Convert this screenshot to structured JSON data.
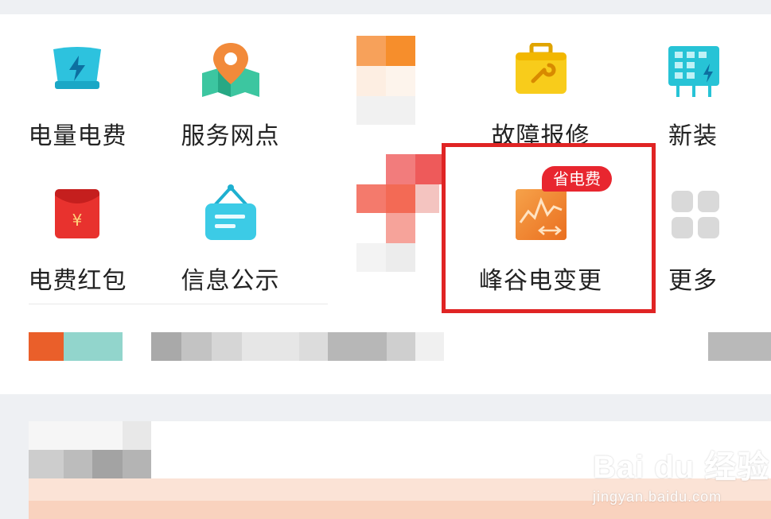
{
  "services": [
    {
      "id": "electricity-bill",
      "label": "电量电费",
      "icon": "lightning-screen-icon"
    },
    {
      "id": "service-outlets",
      "label": "服务网点",
      "icon": "map-pin-icon"
    },
    {
      "id": "fault-repair",
      "label": "故障报修",
      "icon": "toolbox-icon"
    },
    {
      "id": "new-install",
      "label": "新装",
      "icon": "meter-panel-icon"
    },
    {
      "id": "bill-red-packet",
      "label": "电费红包",
      "icon": "red-envelope-icon",
      "icon_text": "¥"
    },
    {
      "id": "info-notice",
      "label": "信息公示",
      "icon": "hanging-sign-icon"
    },
    {
      "id": "peak-valley-change",
      "label": "峰谷电变更",
      "icon": "trend-chart-icon",
      "badge": "省电费"
    },
    {
      "id": "more",
      "label": "更多",
      "icon": "grid-icon"
    }
  ],
  "watermark": {
    "brand": "Bai du 经验",
    "url": "jingyan.baidu.com"
  },
  "colors": {
    "annotation": "#e02424",
    "badge": "#e8262f",
    "accent_orange": "#f0822c"
  }
}
